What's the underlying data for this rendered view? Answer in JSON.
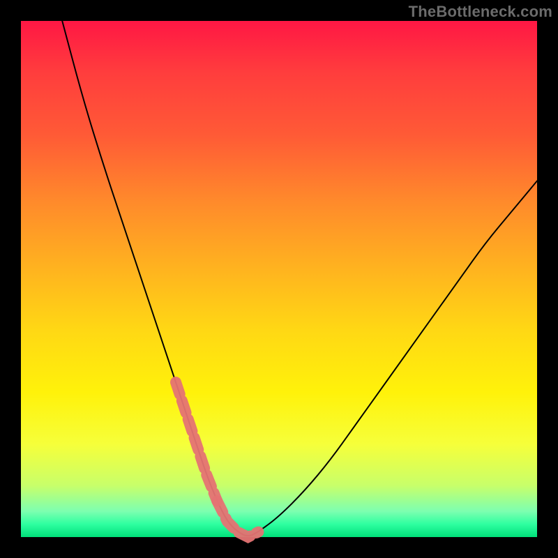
{
  "watermark": "TheBottleneck.com",
  "chart_data": {
    "type": "line",
    "title": "",
    "xlabel": "",
    "ylabel": "",
    "xlim": [
      0,
      100
    ],
    "ylim": [
      0,
      100
    ],
    "grid": false,
    "series": [
      {
        "name": "bottleneck-curve",
        "x": [
          8,
          12,
          16,
          20,
          24,
          28,
          30,
          32,
          34,
          36,
          38,
          40,
          42,
          44,
          46,
          50,
          55,
          60,
          65,
          70,
          75,
          80,
          85,
          90,
          95,
          100
        ],
        "y": [
          100,
          85,
          72,
          60,
          48,
          36,
          30,
          24,
          18,
          12,
          7,
          3,
          1,
          0,
          1,
          4,
          9,
          15,
          22,
          29,
          36,
          43,
          50,
          57,
          63,
          69
        ]
      }
    ],
    "highlight": {
      "name": "optimal-range-markers",
      "color": "#e57373",
      "segments": [
        {
          "x_start": 30,
          "x_end": 38,
          "side": "left"
        },
        {
          "x_start": 38,
          "x_end": 48,
          "side": "floor"
        },
        {
          "x_start": 48,
          "x_end": 54,
          "side": "right"
        }
      ]
    },
    "background_gradient": {
      "direction": "vertical",
      "stops": [
        {
          "pos": 0.0,
          "color": "#ff1744"
        },
        {
          "pos": 0.5,
          "color": "#ffd400"
        },
        {
          "pos": 0.95,
          "color": "#7dffb0"
        },
        {
          "pos": 1.0,
          "color": "#00e07a"
        }
      ]
    }
  }
}
